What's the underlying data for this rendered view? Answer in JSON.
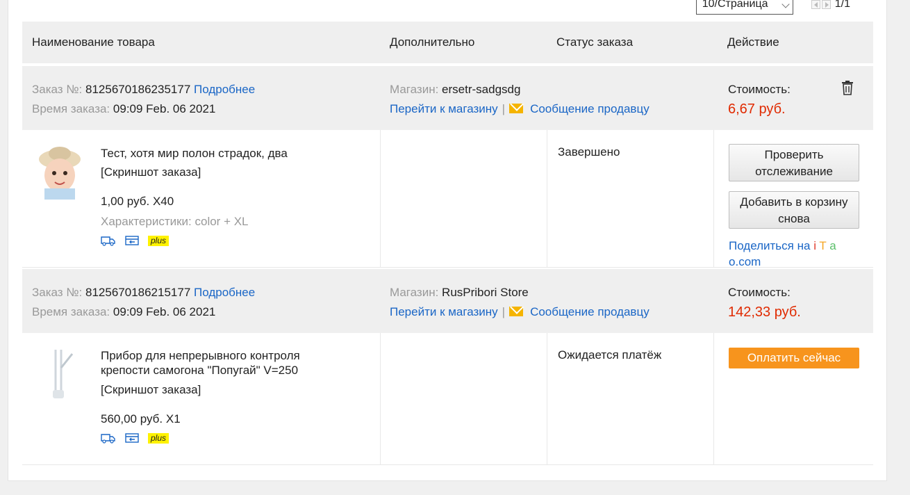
{
  "pager": {
    "select_value": "10/Страница",
    "page_count": "1/1"
  },
  "table_head": {
    "col_product": "Наименование товара",
    "col_extra": "Дополнительно",
    "col_status": "Статус заказа",
    "col_action": "Действие"
  },
  "labels": {
    "order_no": "Заказ №:",
    "details": "Подробнее",
    "order_time": "Время заказа:",
    "store": "Магазин:",
    "goto_store": "Перейти к магазину",
    "separator": "|",
    "message_seller": "Сообщение продавцу",
    "cost": "Стоимость:",
    "screenshot": "[Скриншот заказа]",
    "plus": "plus"
  },
  "orders": [
    {
      "number": "8125670186235177",
      "time": "09:09 Feb. 06 2021",
      "store": "ersetr-sadgsdg",
      "cost": "6,67 руб.",
      "item_title": "Тест, хотя мир полон страдок, два",
      "price_qty": "1,00 руб. X40",
      "specs": "Характеристики: color + XL",
      "status": "Завершено",
      "btn_track": "Проверить отслеживание",
      "btn_recart": "Добавить в корзину снова",
      "share_prefix": "Поделиться на",
      "share_i": "i",
      "share_t": "T",
      "share_a": "a",
      "share_o": "o",
      "share_com": ".com"
    },
    {
      "number": "8125670186215177",
      "time": "09:09 Feb. 06 2021",
      "store": "RusPribori Store",
      "cost": "142,33 руб.",
      "item_title": "Прибор для непрерывного контроля крепости самогона \"Попугай\" V=250",
      "price_qty": "560,00 руб. X1",
      "status": "Ожидается платёж",
      "btn_pay": "Оплатить сейчас"
    }
  ],
  "colors": {
    "link": "#1a66c6",
    "price": "#e02a00",
    "pay": "#f7941d",
    "plus_badge": "#fff200"
  }
}
